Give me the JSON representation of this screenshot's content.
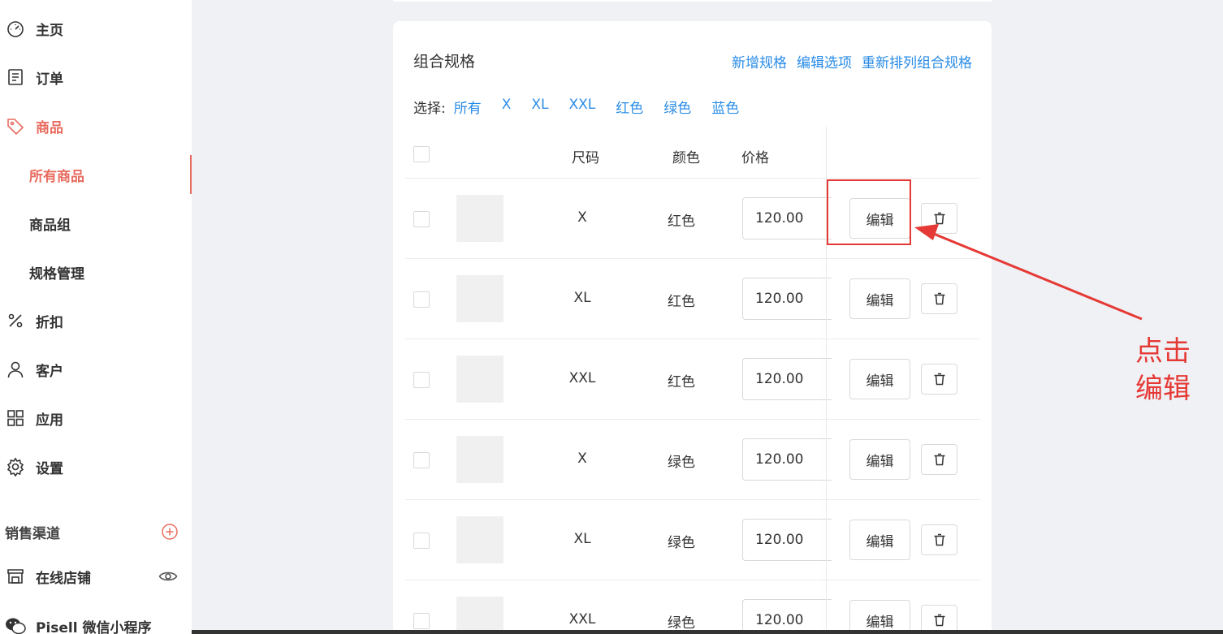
{
  "sidebar": {
    "nav": [
      {
        "label": "主页",
        "icon": "dashboard-icon"
      },
      {
        "label": "订单",
        "icon": "receipt-icon"
      },
      {
        "label": "商品",
        "icon": "tag-icon"
      },
      {
        "label": "折扣",
        "icon": "percent-icon"
      },
      {
        "label": "客户",
        "icon": "user-icon"
      },
      {
        "label": "应用",
        "icon": "apps-grid-icon"
      },
      {
        "label": "设置",
        "icon": "gear-icon"
      }
    ],
    "sub": [
      {
        "label": "所有商品"
      },
      {
        "label": "商品组"
      },
      {
        "label": "规格管理"
      }
    ],
    "channels_label": "销售渠道",
    "channels": [
      {
        "label": "在线店铺",
        "icon": "store-icon"
      },
      {
        "label": "Pisell 微信小程序",
        "icon": "wechat-icon"
      }
    ]
  },
  "card": {
    "title": "组合规格",
    "links": [
      "新增规格",
      "编辑选项",
      "重新排列组合规格"
    ],
    "filter_label": "选择:",
    "filter_options": [
      "所有",
      "X",
      "XL",
      "XXL",
      "红色",
      "绿色",
      "蓝色"
    ],
    "columns": {
      "size": "尺码",
      "color": "颜色",
      "price": "价格"
    },
    "edit_label": "编辑",
    "rows": [
      {
        "size": "X",
        "color": "红色",
        "price": "120.00"
      },
      {
        "size": "XL",
        "color": "红色",
        "price": "120.00"
      },
      {
        "size": "XXL",
        "color": "红色",
        "price": "120.00"
      },
      {
        "size": "X",
        "color": "绿色",
        "price": "120.00"
      },
      {
        "size": "XL",
        "color": "绿色",
        "price": "120.00"
      },
      {
        "size": "XXL",
        "color": "绿色",
        "price": "120.00"
      }
    ]
  },
  "annotation": {
    "line1": "点击",
    "line2": "编辑"
  },
  "colors": {
    "accent": "#e86b5f",
    "link": "#2a8ce6",
    "annotation": "#e53935"
  }
}
